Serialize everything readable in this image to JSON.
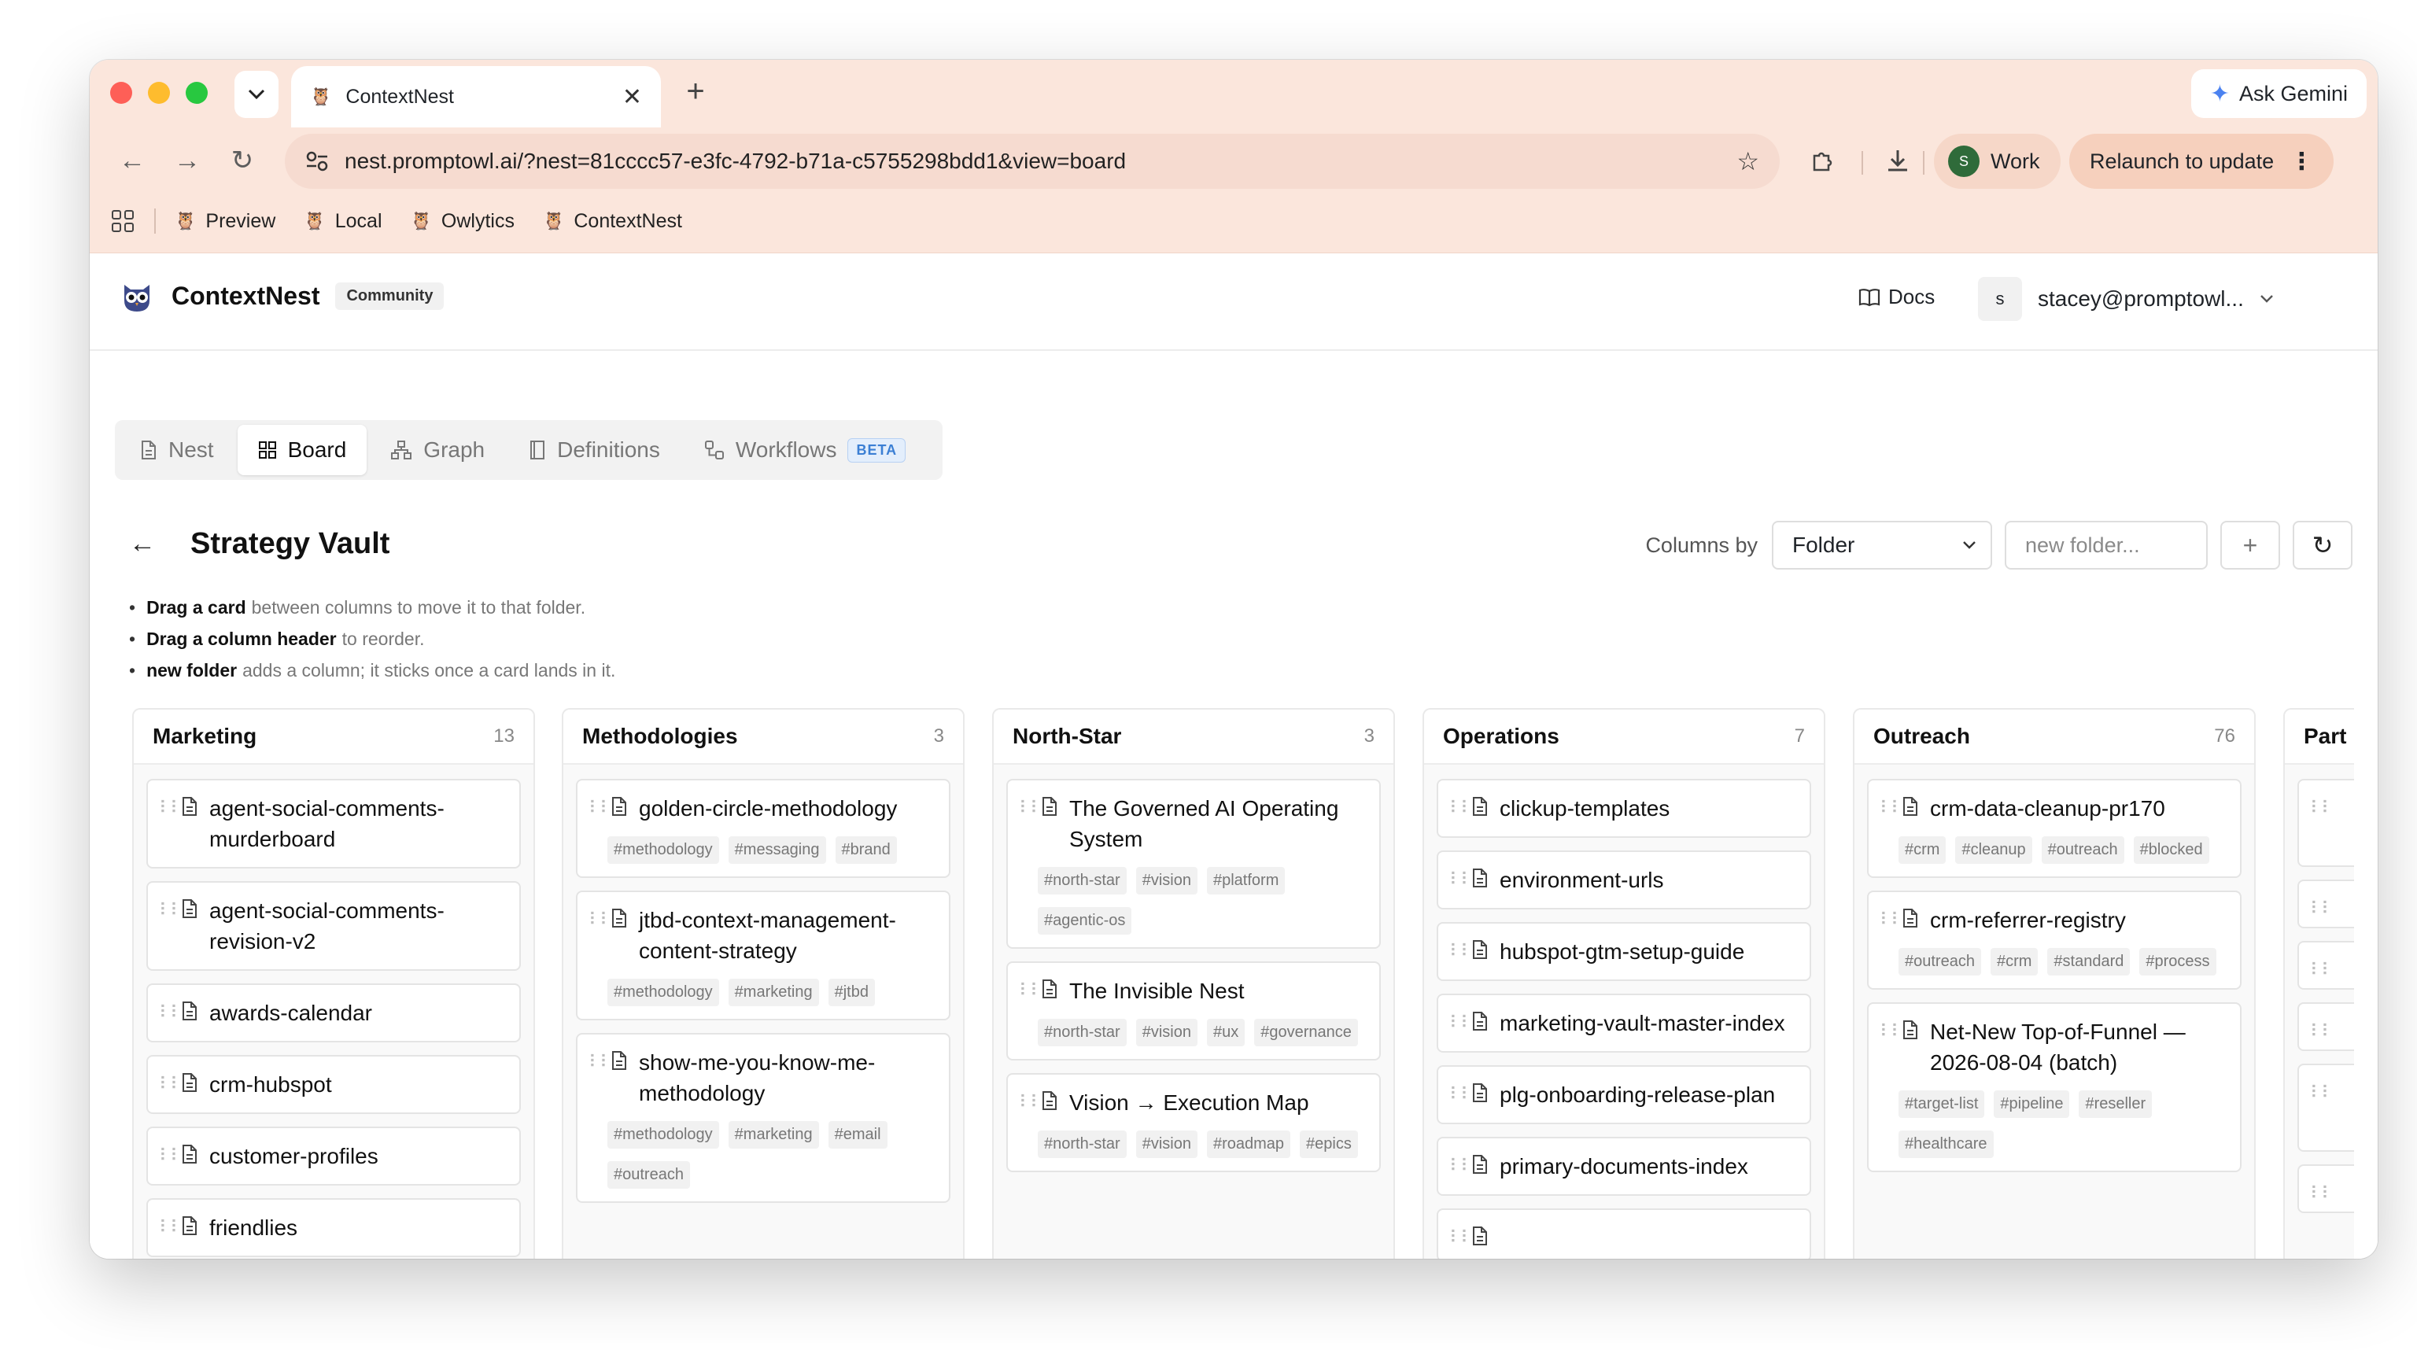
{
  "browser": {
    "tab_title": "ContextNest",
    "url": "nest.promptowl.ai/?nest=81cccc57-e3fc-4792-b71a-c5755298bdd1&view=board",
    "ask_gemini": "Ask Gemini",
    "profile": {
      "initial": "S",
      "label": "Work"
    },
    "relaunch": "Relaunch to update",
    "bookmarks": [
      "Preview",
      "Local",
      "Owlytics",
      "ContextNest"
    ],
    "colors": {
      "chrome": "#fbe6dc",
      "omnibox": "#f6dbd0"
    }
  },
  "app": {
    "name": "ContextNest",
    "badge": "Community",
    "docs": "Docs",
    "user_initial": "s",
    "user_email": "stacey@promptowl...",
    "tabs": [
      {
        "label": "Nest"
      },
      {
        "label": "Board",
        "active": true
      },
      {
        "label": "Graph"
      },
      {
        "label": "Definitions"
      },
      {
        "label": "Workflows",
        "badge": "BETA"
      }
    ]
  },
  "vault": {
    "title": "Strategy Vault",
    "columns_by_label": "Columns by",
    "columns_by_value": "Folder",
    "new_folder_placeholder": "new folder...",
    "hints": [
      {
        "bold": "Drag a card",
        "text": "between columns to move it to that folder."
      },
      {
        "bold": "Drag a column header",
        "text": "to reorder."
      },
      {
        "bold": "new folder",
        "text": "adds a column; it sticks once a card lands in it."
      }
    ]
  },
  "columns": [
    {
      "name": "Marketing",
      "count": "13",
      "cards": [
        {
          "title": "agent-social-comments-murderboard",
          "tags": []
        },
        {
          "title": "agent-social-comments-revision-v2",
          "tags": []
        },
        {
          "title": "awards-calendar",
          "tags": []
        },
        {
          "title": "crm-hubspot",
          "tags": []
        },
        {
          "title": "customer-profiles",
          "tags": []
        },
        {
          "title": "friendlies",
          "tags": []
        },
        {
          "title": "",
          "tags": []
        }
      ]
    },
    {
      "name": "Methodologies",
      "count": "3",
      "cards": [
        {
          "title": "golden-circle-methodology",
          "tags": [
            "#methodology",
            "#messaging",
            "#brand"
          ]
        },
        {
          "title": "jtbd-context-management-content-strategy",
          "tags": [
            "#methodology",
            "#marketing",
            "#jtbd"
          ]
        },
        {
          "title": "show-me-you-know-me-methodology",
          "tags": [
            "#methodology",
            "#marketing",
            "#email",
            "#outreach"
          ]
        }
      ]
    },
    {
      "name": "North-Star",
      "count": "3",
      "cards": [
        {
          "title": "The Governed AI Operating System",
          "tags": [
            "#north-star",
            "#vision",
            "#platform",
            "#agentic-os"
          ]
        },
        {
          "title": "The Invisible Nest",
          "tags": [
            "#north-star",
            "#vision",
            "#ux",
            "#governance"
          ]
        },
        {
          "title": "Vision → Execution Map",
          "tags": [
            "#north-star",
            "#vision",
            "#roadmap",
            "#epics"
          ]
        }
      ]
    },
    {
      "name": "Operations",
      "count": "7",
      "cards": [
        {
          "title": "clickup-templates",
          "tags": []
        },
        {
          "title": "environment-urls",
          "tags": []
        },
        {
          "title": "hubspot-gtm-setup-guide",
          "tags": []
        },
        {
          "title": "marketing-vault-master-index",
          "tags": []
        },
        {
          "title": "plg-onboarding-release-plan",
          "tags": []
        },
        {
          "title": "primary-documents-index",
          "tags": []
        },
        {
          "title": "",
          "tags": []
        }
      ]
    },
    {
      "name": "Outreach",
      "count": "76",
      "cards": [
        {
          "title": "crm-data-cleanup-pr170",
          "tags": [
            "#crm",
            "#cleanup",
            "#outreach",
            "#blocked"
          ]
        },
        {
          "title": "crm-referrer-registry",
          "tags": [
            "#outreach",
            "#crm",
            "#standard",
            "#process"
          ]
        },
        {
          "title": "Net-New Top-of-Funnel — 2026-08-04 (batch)",
          "tags": [
            "#target-list",
            "#pipeline",
            "#reseller",
            "#healthcare"
          ]
        }
      ]
    },
    {
      "name": "Part",
      "count": "",
      "cards": []
    }
  ]
}
